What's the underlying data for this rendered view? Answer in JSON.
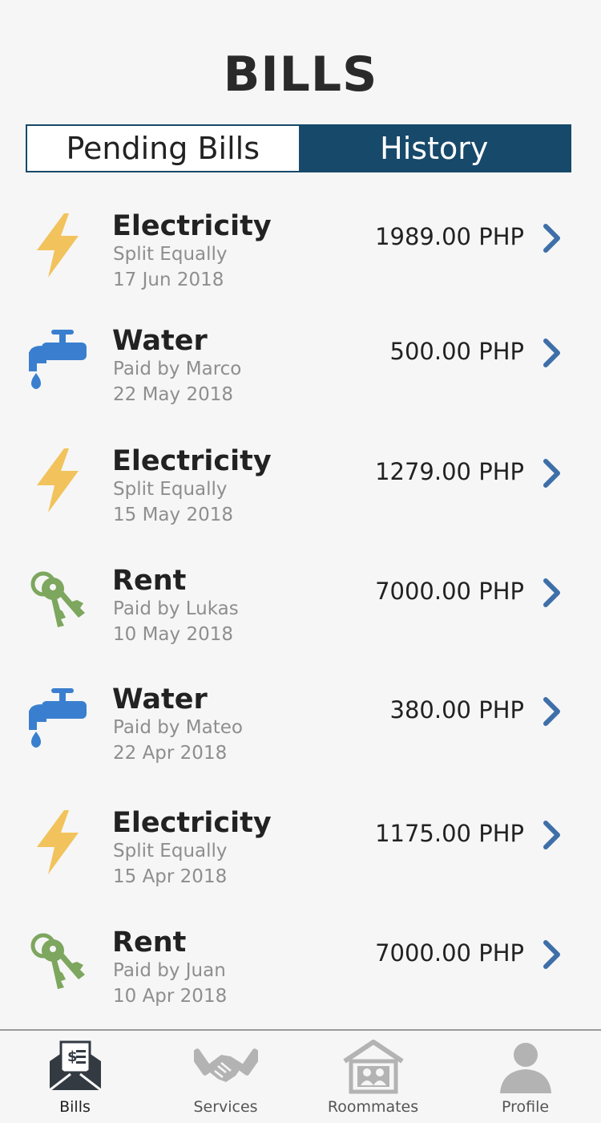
{
  "header": {
    "title": "BILLS"
  },
  "tabs": [
    {
      "label": "Pending Bills",
      "active": false
    },
    {
      "label": "History",
      "active": true
    }
  ],
  "bills": [
    {
      "name": "Electricity",
      "status": "Split Equally",
      "date": "17 Jun 2018",
      "amount": "1989.00 PHP",
      "icon": "lightning-icon"
    },
    {
      "name": "Water",
      "status": "Paid by Marco",
      "date": "22 May 2018",
      "amount": "500.00 PHP",
      "icon": "faucet-icon"
    },
    {
      "name": "Electricity",
      "status": "Split Equally",
      "date": "15 May 2018",
      "amount": "1279.00 PHP",
      "icon": "lightning-icon"
    },
    {
      "name": "Rent",
      "status": "Paid by Lukas",
      "date": "10 May 2018",
      "amount": "7000.00 PHP",
      "icon": "keys-icon"
    },
    {
      "name": "Water",
      "status": "Paid by Mateo",
      "date": "22 Apr 2018",
      "amount": "380.00 PHP",
      "icon": "faucet-icon"
    },
    {
      "name": "Electricity",
      "status": "Split Equally",
      "date": "15 Apr 2018",
      "amount": "1175.00 PHP",
      "icon": "lightning-icon"
    },
    {
      "name": "Rent",
      "status": "Paid by Juan",
      "date": "10 Apr 2018",
      "amount": "7000.00 PHP",
      "icon": "keys-icon"
    }
  ],
  "bottom_nav": [
    {
      "label": "Bills",
      "icon": "bill-envelope-icon",
      "active": true
    },
    {
      "label": "Services",
      "icon": "handshake-icon",
      "active": false
    },
    {
      "label": "Roommates",
      "icon": "house-people-icon",
      "active": false
    },
    {
      "label": "Profile",
      "icon": "person-icon",
      "active": false
    }
  ],
  "colors": {
    "primary": "#17496a",
    "chevron": "#3e6fa8",
    "lightning": "#f2c35c",
    "water": "#3a7fcf",
    "keys": "#7da65e",
    "muted_text": "#8e8e8e",
    "nav_inactive": "#b3b3b3",
    "nav_active": "#333a42"
  }
}
